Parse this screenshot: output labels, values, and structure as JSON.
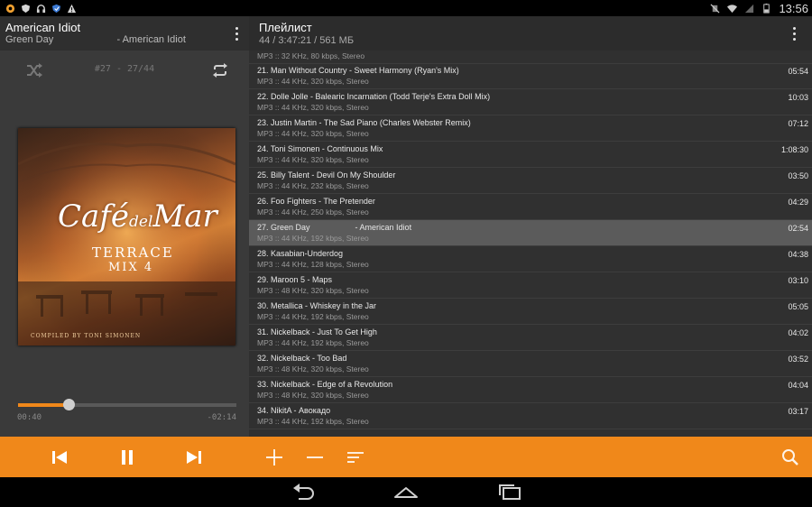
{
  "status_bar": {
    "time": "13:56",
    "icons": [
      "app-icon",
      "shield-icon",
      "headphones-icon",
      "security-icon",
      "warning-icon",
      "mute-icon",
      "wifi-icon",
      "signal-icon",
      "battery-icon"
    ]
  },
  "now_playing": {
    "title": "American Idiot",
    "subtitle": "Green Day                       - American Idiot",
    "track_counter": "#27 - 27/44",
    "elapsed": "00:40",
    "remaining": "-02:14",
    "progress": 0.23,
    "album_art": {
      "cafe": "Café",
      "del": "del",
      "mar": "Mar",
      "terrace": "TERRACE",
      "mix": "MIX 4",
      "compiled": "Compiled by Toni Simonen"
    }
  },
  "playlist": {
    "title": "Плейлист",
    "summary": "44 / 3:47:21 / 561 МБ",
    "top_partial_meta": "MP3 :: 32 KHz, 80 kbps, Stereo",
    "tracks": [
      {
        "title": "21. Man Without Country - Sweet Harmony (Ryan's Mix)",
        "meta": "MP3 :: 44 KHz, 320 kbps, Stereo",
        "duration": "05:54",
        "current": false
      },
      {
        "title": "22. Dolle Jolle - Balearic Incarnation (Todd Terje's Extra Doll Mix)",
        "meta": "MP3 :: 44 KHz, 320 kbps, Stereo",
        "duration": "10:03",
        "current": false
      },
      {
        "title": "23. Justin Martin - The Sad Piano (Charles Webster Remix)",
        "meta": "MP3 :: 44 KHz, 320 kbps, Stereo",
        "duration": "07:12",
        "current": false
      },
      {
        "title": "24. Toni Simonen - Continuous Mix",
        "meta": "MP3 :: 44 KHz, 320 kbps, Stereo",
        "duration": "1:08:30",
        "current": false
      },
      {
        "title": "25. Billy Talent - Devil On My Shoulder",
        "meta": "MP3 :: 44 KHz, 232 kbps, Stereo",
        "duration": "03:50",
        "current": false
      },
      {
        "title": "26. Foo Fighters - The Pretender",
        "meta": "MP3 :: 44 KHz, 250 kbps, Stereo",
        "duration": "04:29",
        "current": false
      },
      {
        "title": "27. Green Day                    - American Idiot",
        "meta": "MP3 :: 44 KHz, 192 kbps, Stereo",
        "duration": "02:54",
        "current": true
      },
      {
        "title": "28. Kasabian-Underdog",
        "meta": "MP3 :: 44 KHz, 128 kbps, Stereo",
        "duration": "04:38",
        "current": false
      },
      {
        "title": "29. Maroon 5 - Maps",
        "meta": "MP3 :: 48 KHz, 320 kbps, Stereo",
        "duration": "03:10",
        "current": false
      },
      {
        "title": "30. Metallica - Whiskey in the Jar",
        "meta": "MP3 :: 44 KHz, 192 kbps, Stereo",
        "duration": "05:05",
        "current": false
      },
      {
        "title": "31. Nickelback - Just To Get High",
        "meta": "MP3 :: 44 KHz, 192 kbps, Stereo",
        "duration": "04:02",
        "current": false
      },
      {
        "title": "32. Nickelback - Too Bad",
        "meta": "MP3 :: 48 KHz, 320 kbps, Stereo",
        "duration": "03:52",
        "current": false
      },
      {
        "title": "33. Nickelback - Edge of a Revolution",
        "meta": "MP3 :: 48 KHz, 320 kbps, Stereo",
        "duration": "04:04",
        "current": false
      },
      {
        "title": "34. NikitA - Авокадо",
        "meta": "MP3 :: 44 KHz, 192 kbps, Stereo",
        "duration": "03:17",
        "current": false
      }
    ]
  },
  "colors": {
    "accent": "#f0881a",
    "current_row": "#5b5b5b"
  },
  "bottom_bar": {
    "buttons": [
      "previous-icon",
      "pause-icon",
      "next-icon",
      "add-icon",
      "remove-icon",
      "sort-icon",
      "search-icon"
    ]
  },
  "nav_bar": {
    "buttons": [
      "back-icon",
      "home-icon",
      "recent-apps-icon"
    ]
  }
}
